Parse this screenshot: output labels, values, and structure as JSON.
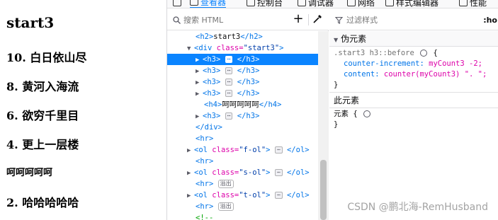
{
  "page": {
    "title": "start3",
    "items": [
      {
        "text": "10. 白日依山尽",
        "level": "h3"
      },
      {
        "text": "8. 黄河入海流",
        "level": "h3"
      },
      {
        "text": "6. 欲穷千里目",
        "level": "h3"
      },
      {
        "text": "4. 更上一层楼",
        "level": "h3"
      },
      {
        "text": "呵呵呵呵呵",
        "level": "h4"
      },
      {
        "text": "2. 哈哈哈哈哈",
        "level": "h3"
      }
    ]
  },
  "devtools": {
    "tabs": [
      "查看器",
      "控制台",
      "调试器",
      "网络",
      "样式编辑器",
      "性能"
    ],
    "search": {
      "placeholder": "搜索 HTML"
    },
    "add_node": "+",
    "markup": {
      "h2_open": "<h2>",
      "h2_text": "start3",
      "h2_close": "</h2>",
      "div_open": "<div",
      "div_attr": "class=",
      "div_val": "\"start3\"",
      "div_gt": ">",
      "h3_open": "<h3>",
      "h3_close": "</h3>",
      "h4_open": "<h4>",
      "h4_text": "呵呵呵呵呵",
      "h4_close": "</h4>",
      "div_close": "</div>",
      "hr": "<hr>",
      "ol_open": "<ol",
      "ol_attr": "class=",
      "ol_gt": ">",
      "ol_close": "</ol>",
      "ol_classes": [
        "\"f-ol\"",
        "\"s-ol\"",
        "\"t-ol\""
      ],
      "overflow_badge": "溢出",
      "comment": "<!--",
      "dots": "⋯"
    },
    "rules": {
      "filter_placeholder": "过滤样式",
      "hov": ":ho",
      "pseudo_section": "伪元素",
      "selector": ".start3 h3::before",
      "brace_open": "{",
      "decl1_prop": "counter-increment:",
      "decl1_val": "myCount3 -2;",
      "decl2_prop": "content:",
      "decl2_val": "counter(myCount3) \". \";",
      "brace_close": "}",
      "element_section": "此元素",
      "element_selector": "元素",
      "element_brace_open": "{",
      "element_brace_close": "}"
    }
  },
  "watermark": "CSDN @鹏北海-RemHusband"
}
